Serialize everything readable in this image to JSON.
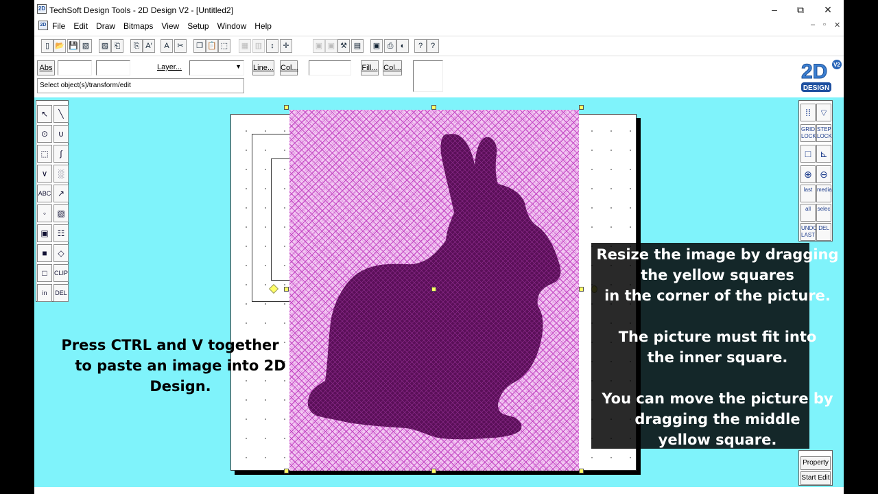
{
  "window": {
    "title": "TechSoft Design Tools - 2D Design V2 - [Untitled2]",
    "app_icon": "2D",
    "controls": {
      "minimize": "–",
      "restore": "⧉",
      "close": "✕"
    },
    "mdi_controls": {
      "minimize": "–",
      "restore": "▫",
      "close": "✕"
    }
  },
  "menu": [
    "File",
    "Edit",
    "Draw",
    "Bitmaps",
    "View",
    "Setup",
    "Window",
    "Help"
  ],
  "toolbar": {
    "icons": [
      "new-icon",
      "open-icon",
      "save-icon",
      "print-setup-icon",
      "save-as-icon",
      "import-icon",
      "export-icon",
      "text-style-icon",
      "text-outline-icon",
      "cut-icon",
      "copy-icon",
      "paste-icon",
      "select-icon",
      "group-icon",
      "ungroup-icon",
      "transform-icon",
      "move-icon",
      "align-icon",
      "arrange-icon",
      "zoom-box-icon",
      "flip-icon",
      "window-icon",
      "printer-icon",
      "palette-icon",
      "context-help-icon",
      "help-icon"
    ],
    "glyphs": [
      "▯",
      "📂",
      "💾",
      "▧",
      "▨",
      "⎗",
      "⎘",
      "A′",
      "A",
      "✂",
      "❐",
      "📋",
      "⬚",
      "▦",
      "▥",
      "↕",
      "✛",
      "▣",
      "▣",
      "⚒",
      "▤",
      "▣",
      "⎙",
      "◐",
      "?",
      "?"
    ]
  },
  "props": {
    "abs_label": "Abs",
    "layer_label": "Layer...",
    "line_label": "Line...",
    "col_label": "Col...",
    "fill_label": "Fill...",
    "col2_label": "Col...",
    "status": "Select object(s)/transform/edit"
  },
  "logo": {
    "text": "2D",
    "badge": "V2",
    "sub": "DESIGN"
  },
  "left_tools": [
    "↖",
    "╲",
    "⊙",
    "∪",
    "⬚",
    "∫",
    "∨",
    "░",
    "ABC",
    "↗",
    "◦",
    "▧",
    "▣",
    "☷",
    "■",
    "◇",
    "□",
    "CLIP",
    "in",
    "DEL"
  ],
  "right_tools": {
    "grid": "GRID LOCK",
    "step": "STEP LOCK",
    "last": "last",
    "media": "media",
    "all": "all",
    "selec": "selec",
    "undo": "UNDO LAST",
    "del": "DEL"
  },
  "right_panel": {
    "property": "Property",
    "start_edit": "Start Edit"
  },
  "overlay": {
    "left_line1": "Press CTRL and V together",
    "left_line2": "to paste an image into 2D Design.",
    "right_l1": "Resize the image by dragging",
    "right_l2": "the yellow squares",
    "right_l3": "in the corner of the picture.",
    "right_l4": "The picture must fit into",
    "right_l5": "the inner square.",
    "right_l6": "You can move the picture by",
    "right_l7": "dragging the middle",
    "right_l8": "yellow square."
  },
  "colors": {
    "canvas": "#7ff3fb",
    "picture_bg": "#f3c9f3",
    "hatch": "#c54ac5",
    "rabbit": "#5a0f58",
    "handle": "#ffff66"
  }
}
